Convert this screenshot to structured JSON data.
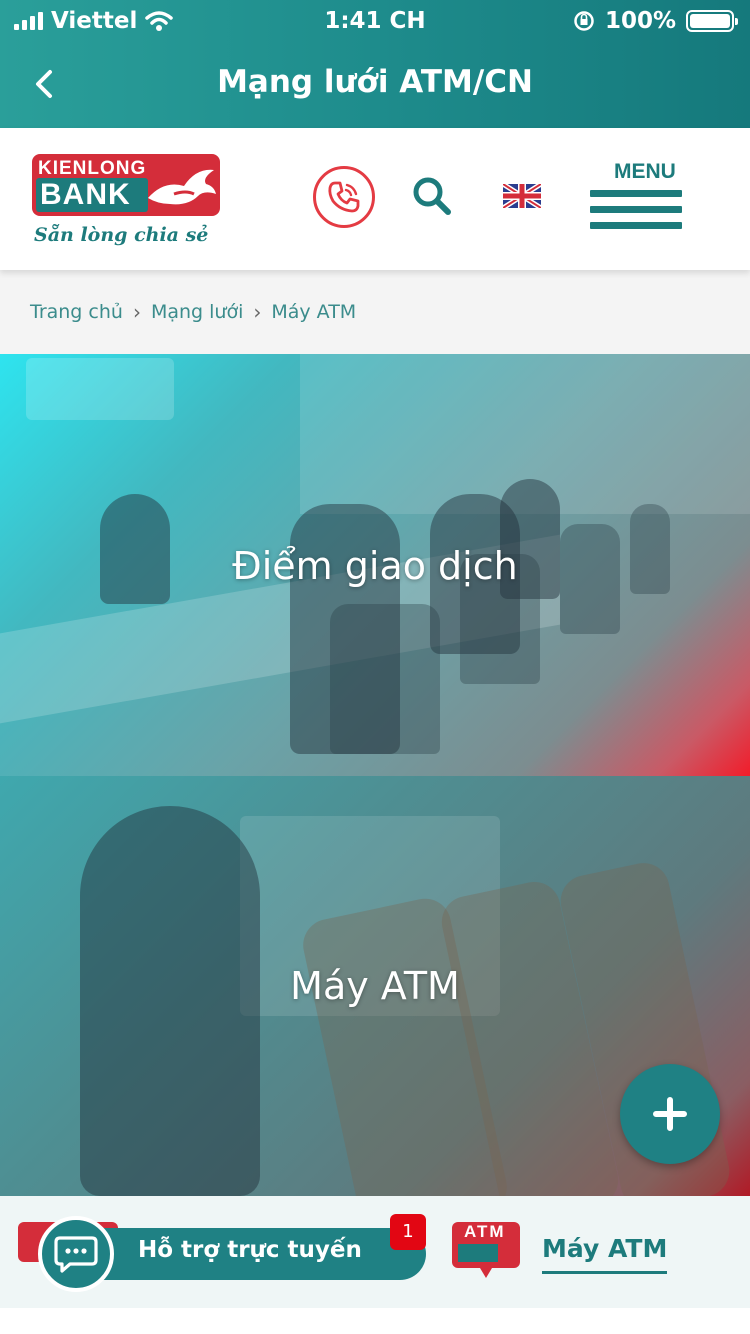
{
  "status_bar": {
    "carrier": "Viettel",
    "time": "1:41 CH",
    "battery": "100%"
  },
  "nav": {
    "title": "Mạng lưới ATM/CN"
  },
  "header": {
    "logo_top": "KIENLONG",
    "logo_bank": "BANK",
    "tagline": "Sẵn lòng chia sẻ",
    "menu_label": "MENU",
    "icons": [
      "phone-icon",
      "search-icon",
      "uk-flag-icon",
      "hamburger-icon"
    ]
  },
  "breadcrumb": {
    "items": [
      "Trang chủ",
      "Mạng lưới",
      "Máy ATM"
    ]
  },
  "cards": [
    {
      "title": "Điểm giao dịch"
    },
    {
      "title": "Máy ATM"
    }
  ],
  "fab": {
    "label": "+"
  },
  "bottom_bar": {
    "support_label": "Hỗ trợ trực tuyến",
    "badge_count": "1",
    "atm_icon_text": "ATM",
    "atm_label": "Máy ATM"
  },
  "colors": {
    "brand_teal": "#1d7b7c",
    "brand_red": "#d42d3a",
    "nav_gradient_start": "#2a9f9a",
    "nav_gradient_end": "#15797c"
  }
}
